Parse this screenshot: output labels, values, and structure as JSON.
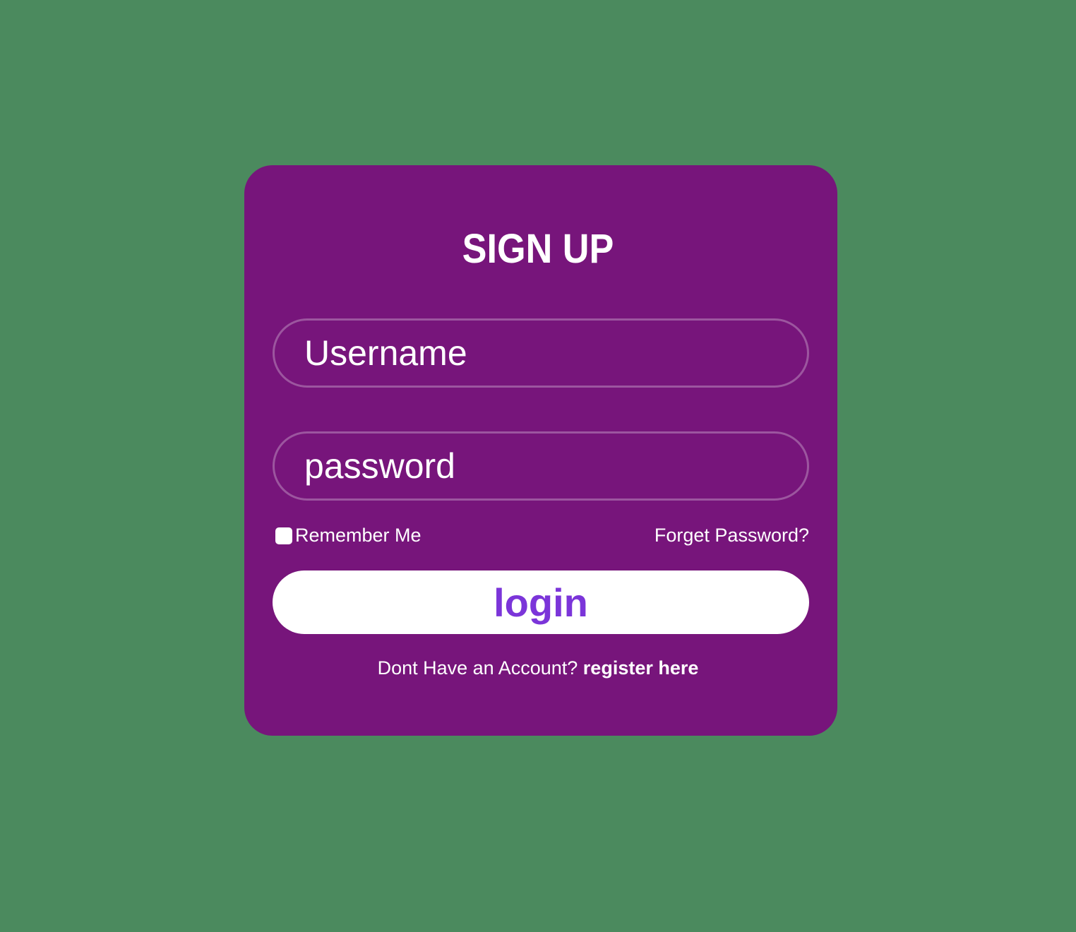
{
  "form": {
    "title": "SIGN UP",
    "username_placeholder": "Username",
    "password_placeholder": "password",
    "remember_label": "Remember Me",
    "remember_checked": false,
    "forget_label": "Forget Password?",
    "login_label": "login",
    "footer_text": "Dont Have an Account?",
    "register_label": "register here"
  },
  "colors": {
    "background": "#4b8a5e",
    "card": "#77157b",
    "button_text": "#7b35d9",
    "text": "#ffffff"
  }
}
